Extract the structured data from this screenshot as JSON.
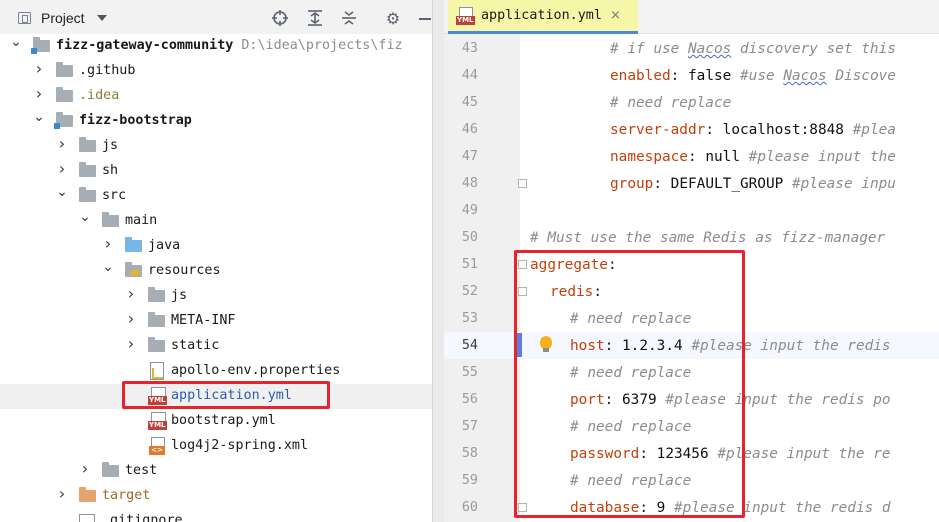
{
  "project_panel": {
    "title": "Project",
    "toolbar": [
      "locate-icon",
      "expand-all-icon",
      "collapse-all-icon",
      "gear-icon",
      "hide-icon"
    ],
    "tree": [
      {
        "label": "fizz-gateway-community",
        "hint": "D:\\idea\\projects\\fiz",
        "icon": "module-folder",
        "state": "expanded",
        "depth": 0,
        "bold": true
      },
      {
        "label": ".github",
        "icon": "folder",
        "state": "collapsed",
        "depth": 1
      },
      {
        "label": ".idea",
        "icon": "folder",
        "state": "collapsed",
        "depth": 1,
        "muted": true
      },
      {
        "label": "fizz-bootstrap",
        "icon": "module-folder",
        "state": "expanded",
        "depth": 1,
        "bold": true
      },
      {
        "label": "js",
        "icon": "folder",
        "state": "collapsed",
        "depth": 2
      },
      {
        "label": "sh",
        "icon": "folder",
        "state": "collapsed",
        "depth": 2
      },
      {
        "label": "src",
        "icon": "folder",
        "state": "expanded",
        "depth": 2
      },
      {
        "label": "main",
        "icon": "folder",
        "state": "expanded",
        "depth": 3
      },
      {
        "label": "java",
        "icon": "source-folder",
        "state": "collapsed",
        "depth": 4
      },
      {
        "label": "resources",
        "icon": "resources-folder",
        "state": "expanded",
        "depth": 4
      },
      {
        "label": "js",
        "icon": "folder",
        "state": "collapsed",
        "depth": 5
      },
      {
        "label": "META-INF",
        "icon": "folder",
        "state": "collapsed",
        "depth": 5
      },
      {
        "label": "static",
        "icon": "folder",
        "state": "collapsed",
        "depth": 5
      },
      {
        "label": "apollo-env.properties",
        "icon": "properties-file",
        "state": "leaf",
        "depth": 5
      },
      {
        "label": "application.yml",
        "icon": "yml-file",
        "state": "leaf",
        "depth": 5,
        "selected": true
      },
      {
        "label": "bootstrap.yml",
        "icon": "yml-file",
        "state": "leaf",
        "depth": 5
      },
      {
        "label": "log4j2-spring.xml",
        "icon": "xml-file",
        "state": "leaf",
        "depth": 5
      },
      {
        "label": "test",
        "icon": "folder",
        "state": "collapsed",
        "depth": 3
      },
      {
        "label": "target",
        "icon": "excluded-folder",
        "state": "collapsed",
        "depth": 2,
        "orange": true
      },
      {
        "label": ".gitignore",
        "icon": "git-file",
        "state": "leaf",
        "depth": 2
      }
    ]
  },
  "editor": {
    "tab": {
      "label": "application.yml",
      "icon": "yml-file-icon"
    },
    "current_line": 54,
    "lines": [
      {
        "num": 43,
        "indent": 4,
        "key": "",
        "value": "",
        "comment": "# if use Nacos discovery set this"
      },
      {
        "num": 44,
        "indent": 4,
        "key": "enabled",
        "value": "false",
        "comment": "#use Nacos Discove"
      },
      {
        "num": 45,
        "indent": 4,
        "key": "",
        "value": "",
        "comment": "# need replace"
      },
      {
        "num": 46,
        "indent": 4,
        "key": "server-addr",
        "value": "localhost:8848",
        "comment": "#plea"
      },
      {
        "num": 47,
        "indent": 4,
        "key": "namespace",
        "value": "null",
        "comment": "#please input the"
      },
      {
        "num": 48,
        "indent": 4,
        "key": "group",
        "value": "DEFAULT_GROUP",
        "comment": "#please inpu"
      },
      {
        "num": 49,
        "indent": 0,
        "key": "",
        "value": "",
        "comment": ""
      },
      {
        "num": 50,
        "indent": 0,
        "key": "",
        "value": "",
        "comment": "# Must use the same Redis as fizz-manager"
      },
      {
        "num": 51,
        "indent": 0,
        "key": "aggregate",
        "value": "",
        "comment": ""
      },
      {
        "num": 52,
        "indent": 1,
        "key": "redis",
        "value": "",
        "comment": ""
      },
      {
        "num": 53,
        "indent": 2,
        "key": "",
        "value": "",
        "comment": "# need replace"
      },
      {
        "num": 54,
        "indent": 2,
        "key": "host",
        "value": "1.2.3.4",
        "comment": "#please input the redis"
      },
      {
        "num": 55,
        "indent": 2,
        "key": "",
        "value": "",
        "comment": "# need replace"
      },
      {
        "num": 56,
        "indent": 2,
        "key": "port",
        "value": "6379",
        "comment": "#please input the redis po"
      },
      {
        "num": 57,
        "indent": 2,
        "key": "",
        "value": "",
        "comment": "# need replace"
      },
      {
        "num": 58,
        "indent": 2,
        "key": "password",
        "value": "123456",
        "comment": "#please input the re"
      },
      {
        "num": 59,
        "indent": 2,
        "key": "",
        "value": "",
        "comment": "# need replace"
      },
      {
        "num": 60,
        "indent": 2,
        "key": "database",
        "value": "9",
        "comment": "#please input the redis d"
      }
    ]
  },
  "colors": {
    "yaml_key": "#c2410c",
    "comment": "#8c8c8c",
    "highlight_box": "#e5242b",
    "active_tab": "#f5f6a8"
  }
}
